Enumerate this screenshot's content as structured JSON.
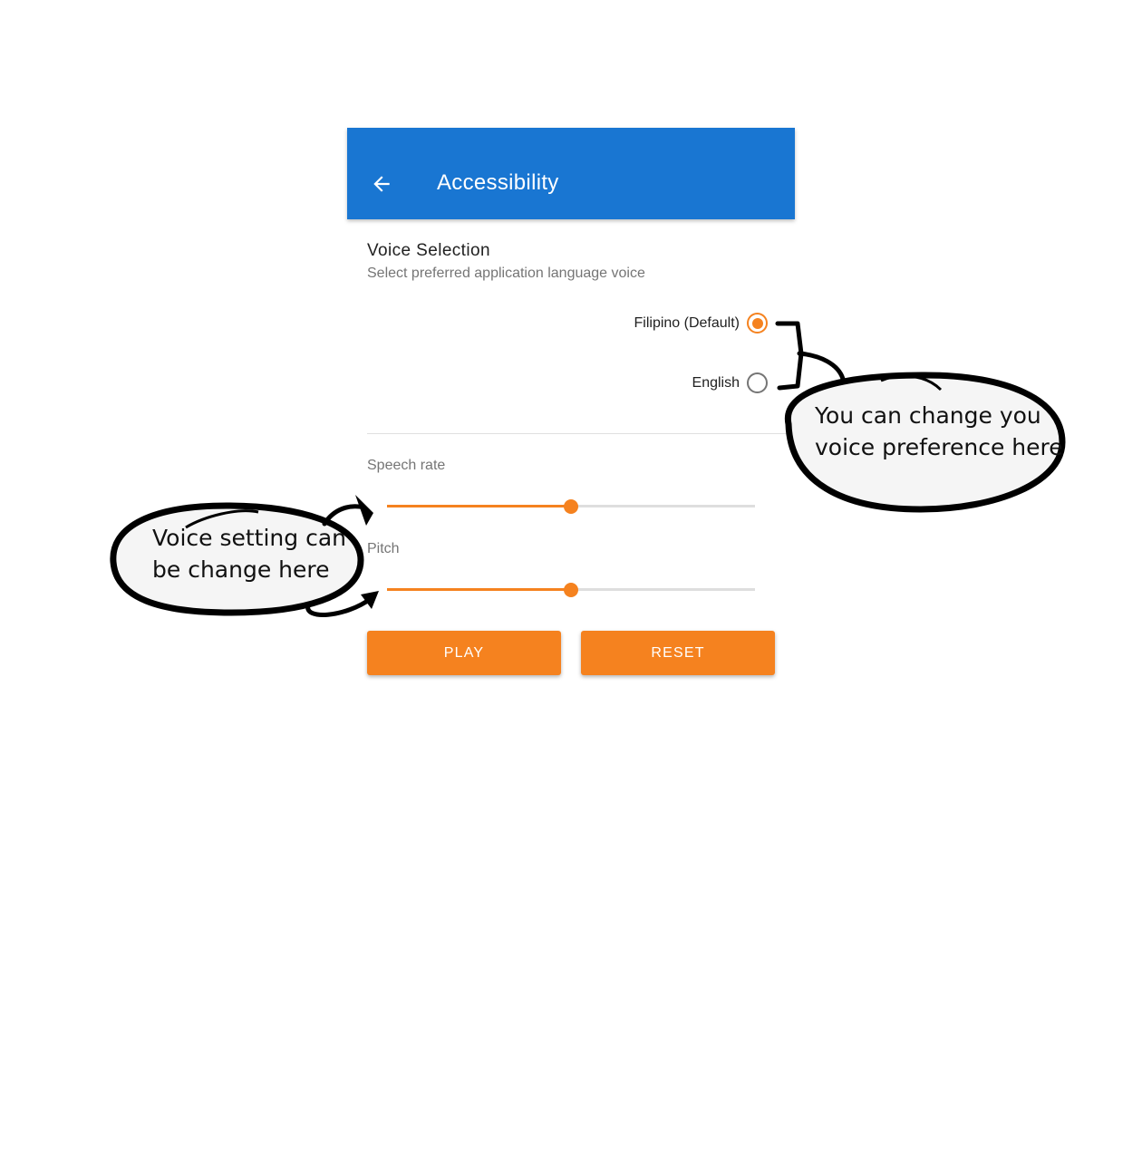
{
  "appbar": {
    "back_icon": "arrow-back-icon",
    "title": "Accessibility",
    "color": "#1976d2"
  },
  "voice_selection": {
    "title": "Voice Selection",
    "subtitle": "Select preferred application language voice",
    "options": [
      {
        "label": "Filipino (Default)",
        "selected": true
      },
      {
        "label": "English",
        "selected": false
      }
    ]
  },
  "speech_rate": {
    "label": "Speech rate",
    "value_fraction": 0.5
  },
  "pitch": {
    "label": "Pitch",
    "value_fraction": 0.5
  },
  "buttons": {
    "play": "PLAY",
    "reset": "RESET"
  },
  "annotations": {
    "voice_preference": [
      "You can change you",
      "voice preference here"
    ],
    "voice_setting": [
      "Voice setting can",
      "be change here"
    ]
  },
  "colors": {
    "accent": "#f5821f",
    "primary": "#1976d2",
    "bubble_fill": "#f5f5f5",
    "bubble_stroke": "#000000"
  }
}
